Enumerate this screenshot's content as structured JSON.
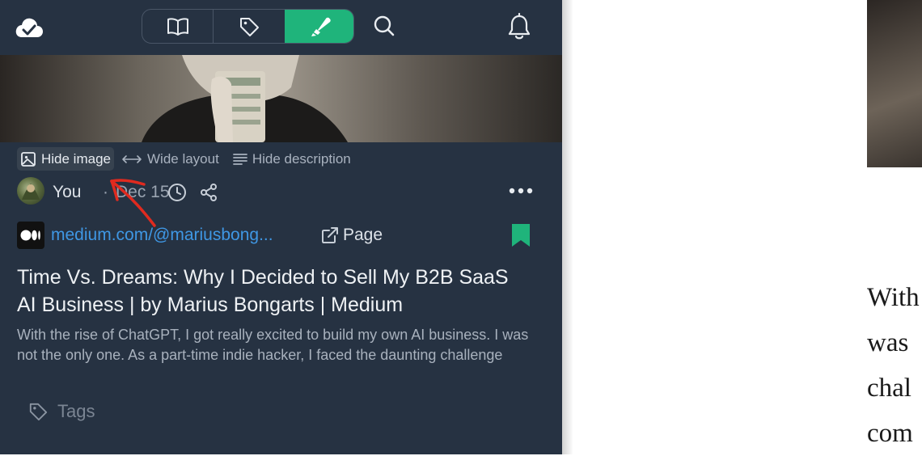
{
  "toolbar": {
    "hide_image": "Hide image",
    "wide_layout": "Wide layout",
    "hide_description": "Hide description"
  },
  "meta": {
    "author": "You",
    "separator": "·",
    "date": "Dec 15"
  },
  "source": {
    "link": "medium.com/@mariusbong...",
    "page_label": "Page"
  },
  "article": {
    "title": "Time Vs. Dreams: Why I Decided to Sell My B2B SaaS AI Business | by Marius Bongarts | Medium",
    "description": "With the rise of ChatGPT, I got really excited to build my own AI business. I was not the only one. As a part-time indie hacker, I faced the daunting challenge"
  },
  "tags": {
    "label": "Tags"
  },
  "right_article": {
    "lines": [
      "With",
      "was",
      "chal",
      "com"
    ]
  },
  "colors": {
    "panel_bg": "#263242",
    "accent_green": "#1fb47b",
    "link_blue": "#3f97e4",
    "annotation_red": "#e02a1f"
  },
  "icons": [
    "cloud-check-icon",
    "book-icon",
    "tag-icon",
    "highlighter-icon",
    "search-icon",
    "bell-icon",
    "image-icon",
    "arrows-horizontal-icon",
    "lines-icon",
    "clock-icon",
    "share-icon",
    "more-icon",
    "medium-logo-icon",
    "external-link-icon",
    "bookmark-icon",
    "tag-icon"
  ]
}
